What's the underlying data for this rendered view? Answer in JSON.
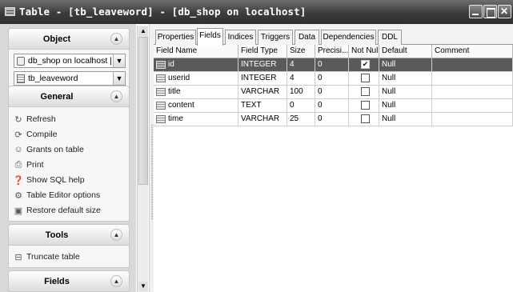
{
  "window": {
    "title": "Table - [tb_leaveword] - [db_shop on localhost]"
  },
  "sidebar": {
    "object_panel": {
      "title": "Object",
      "database_combo": "db_shop on localhost [",
      "table_combo": "tb_leaveword"
    },
    "general_panel": {
      "title": "General",
      "actions": [
        {
          "label": "Refresh",
          "icon": "refresh-icon"
        },
        {
          "label": "Compile",
          "icon": "compile-icon"
        },
        {
          "label": "Grants on table",
          "icon": "grants-icon"
        },
        {
          "label": "Print",
          "icon": "print-icon"
        },
        {
          "label": "Show SQL help",
          "icon": "help-icon"
        },
        {
          "label": "Table Editor options",
          "icon": "options-icon"
        },
        {
          "label": "Restore default size",
          "icon": "restore-size-icon"
        }
      ]
    },
    "tools_panel": {
      "title": "Tools",
      "actions": [
        {
          "label": "Truncate table",
          "icon": "truncate-icon"
        }
      ]
    },
    "fields_panel": {
      "title": "Fields"
    }
  },
  "tabs": [
    {
      "label": "Properties",
      "active": false
    },
    {
      "label": "Fields",
      "active": true
    },
    {
      "label": "Indices",
      "active": false
    },
    {
      "label": "Triggers",
      "active": false
    },
    {
      "label": "Data",
      "active": false
    },
    {
      "label": "Dependencies",
      "active": false
    },
    {
      "label": "DDL",
      "active": false
    }
  ],
  "grid": {
    "columns": [
      "Field Name",
      "Field Type",
      "Size",
      "Precisi...",
      "Not Null",
      "Default",
      "Comment"
    ],
    "rows": [
      {
        "name": "id",
        "type": "INTEGER",
        "size": "4",
        "precision": "0",
        "not_null": true,
        "default": "Null",
        "comment": "",
        "selected": true
      },
      {
        "name": "userid",
        "type": "INTEGER",
        "size": "4",
        "precision": "0",
        "not_null": false,
        "default": "Null",
        "comment": "",
        "selected": false
      },
      {
        "name": "title",
        "type": "VARCHAR",
        "size": "100",
        "precision": "0",
        "not_null": false,
        "default": "Null",
        "comment": "",
        "selected": false
      },
      {
        "name": "content",
        "type": "TEXT",
        "size": "0",
        "precision": "0",
        "not_null": false,
        "default": "Null",
        "comment": "",
        "selected": false
      },
      {
        "name": "time",
        "type": "VARCHAR",
        "size": "25",
        "precision": "0",
        "not_null": false,
        "default": "Null",
        "comment": "",
        "selected": false
      }
    ]
  }
}
